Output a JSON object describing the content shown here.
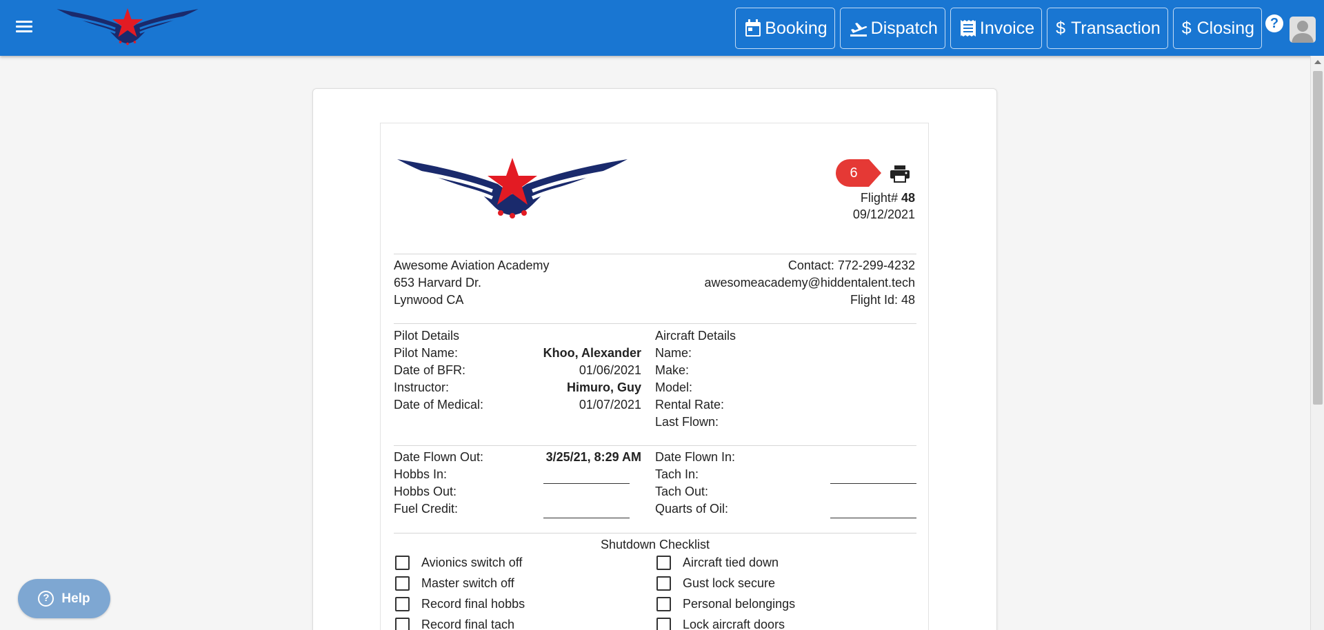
{
  "nav": {
    "booking": "Booking",
    "dispatch": "Dispatch",
    "invoice": "Invoice",
    "transaction": "Transaction",
    "closing": "Closing"
  },
  "help_glyph": "?",
  "header": {
    "badge_number": "6",
    "flight_label": "Flight#",
    "flight_number": "48",
    "date": "09/12/2021"
  },
  "academy": {
    "name": "Awesome Aviation Academy",
    "address": "653 Harvard Dr.",
    "city": "Lynwood CA",
    "contact": "Contact: 772-299-4232",
    "email": "awesomeacademy@hiddentalent.tech",
    "flight_id": "Flight Id: 48"
  },
  "pilot": {
    "title": "Pilot Details",
    "name_label": "Pilot Name:",
    "name_value": "Khoo, Alexander",
    "bfr_label": "Date of BFR:",
    "bfr_value": "01/06/2021",
    "instructor_label": "Instructor:",
    "instructor_value": "Himuro, Guy",
    "medical_label": "Date of Medical:",
    "medical_value": "01/07/2021"
  },
  "aircraft": {
    "title": "Aircraft Details",
    "name_label": "Name:",
    "make_label": "Make:",
    "model_label": "Model:",
    "rate_label": "Rental Rate:",
    "last_flown_label": "Last Flown:"
  },
  "flight": {
    "out_label": "Date Flown Out:",
    "out_value": "3/25/21, 8:29 AM",
    "hobbs_in_label": "Hobbs In:",
    "hobbs_out_label": "Hobbs Out:",
    "fuel_label": "Fuel Credit:",
    "in_label": "Date Flown In:",
    "tach_in_label": "Tach In:",
    "tach_out_label": "Tach Out:",
    "oil_label": "Quarts of Oil:"
  },
  "checklist": {
    "title": "Shutdown Checklist",
    "left": [
      "Avionics switch off",
      "Master switch off",
      "Record final hobbs",
      "Record final tach"
    ],
    "right": [
      "Aircraft tied down",
      "Gust lock secure",
      "Personal belongings",
      "Lock aircraft doors"
    ]
  },
  "help_button": "Help",
  "colors": {
    "brand": "#1976d2",
    "badge": "#e53935",
    "logo_navy": "#1a2a6c",
    "logo_red": "#e31b23"
  }
}
